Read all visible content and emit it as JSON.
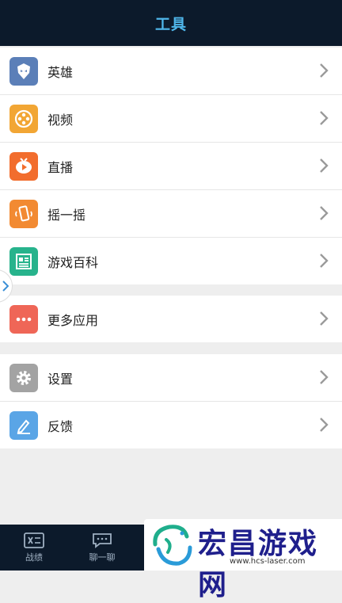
{
  "header": {
    "title": "工具"
  },
  "groups": [
    {
      "items": [
        {
          "label": "英雄",
          "icon": "hero-mask-icon",
          "color": "#5b7fb8"
        },
        {
          "label": "视频",
          "icon": "film-reel-icon",
          "color": "#f2a634"
        },
        {
          "label": "直播",
          "icon": "live-play-icon",
          "color": "#f26d2d"
        },
        {
          "label": "摇一摇",
          "icon": "shake-phone-icon",
          "color": "#f28a32"
        },
        {
          "label": "游戏百科",
          "icon": "encyclopedia-icon",
          "color": "#27b38c"
        }
      ]
    },
    {
      "items": [
        {
          "label": "更多应用",
          "icon": "more-dots-icon",
          "color": "#ef6657"
        }
      ]
    },
    {
      "items": [
        {
          "label": "设置",
          "icon": "gear-icon",
          "color": "#a3a3a3"
        },
        {
          "label": "反馈",
          "icon": "pencil-icon",
          "color": "#5aa5e6"
        }
      ]
    }
  ],
  "tabbar": {
    "tabs": [
      {
        "label": "战绩"
      },
      {
        "label": "聊一聊"
      }
    ]
  },
  "watermark": {
    "text": "宏昌游戏网",
    "url": "www.hcs-laser.com"
  }
}
